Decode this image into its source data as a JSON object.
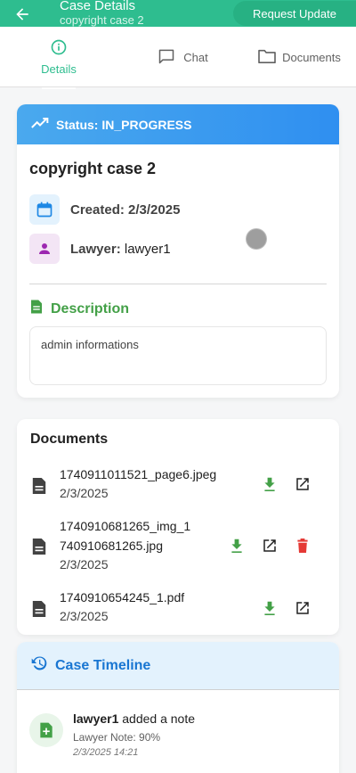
{
  "appbar": {
    "title": "Case Details",
    "subtitle": "copyright case 2",
    "request_button": "Request Update"
  },
  "tabs": [
    {
      "label": "Details",
      "icon": "info-icon",
      "active": true
    },
    {
      "label": "Chat",
      "icon": "chat-icon",
      "active": false
    },
    {
      "label": "Documents",
      "icon": "folder-icon",
      "active": false
    }
  ],
  "status": {
    "label": "Status: IN_PROGRESS",
    "case_name": "copyright case 2",
    "created_label": "Created:",
    "created_value": "2/3/2025",
    "lawyer_label": "Lawyer:",
    "lawyer_value": "lawyer1",
    "description_title": "Description",
    "description_text": "admin informations"
  },
  "documents": {
    "title": "Documents",
    "items": [
      {
        "name": "1740911011521_page6.jpeg",
        "date": "2/3/2025",
        "deletable": false
      },
      {
        "name_line1": "1740910681265_img_1",
        "name_line2": "740910681265.jpg",
        "date": "2/3/2025",
        "deletable": true
      },
      {
        "name": "1740910654245_1.pdf",
        "date": "2/3/2025",
        "deletable": false
      }
    ]
  },
  "timeline": {
    "title": "Case Timeline",
    "entries": [
      {
        "who": "lawyer1",
        "action": "added a note",
        "detail": "Lawyer Note: 90%",
        "time": "2/3/2025 14:21"
      }
    ]
  },
  "colors": {
    "primary": "#2ebd8f",
    "status_blue": "#2f8ff0",
    "green": "#43a047",
    "red": "#e53935",
    "timeline_blue": "#1976d2"
  }
}
